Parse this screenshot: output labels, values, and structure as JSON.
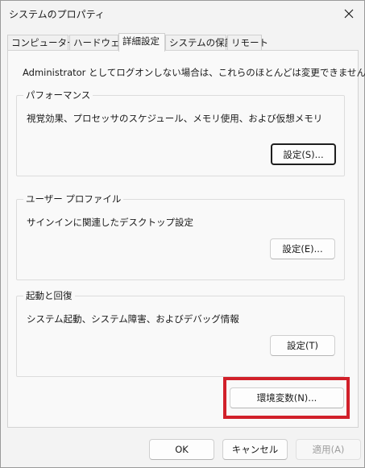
{
  "window": {
    "title": "システムのプロパティ",
    "close_icon": "×"
  },
  "tabs": [
    {
      "label": "コンピューター名",
      "active": false
    },
    {
      "label": "ハードウェア",
      "active": false
    },
    {
      "label": "詳細設定",
      "active": true
    },
    {
      "label": "システムの保護",
      "active": false
    },
    {
      "label": "リモート",
      "active": false
    }
  ],
  "advanced": {
    "admin_note": "Administrator としてログオンしない場合は、これらのほとんどは変更できません。",
    "performance": {
      "title": "パフォーマンス",
      "description": "視覚効果、プロセッサのスケジュール、メモリ使用、および仮想メモリ",
      "button": "設定(S)..."
    },
    "user_profiles": {
      "title": "ユーザー プロファイル",
      "description": "サインインに関連したデスクトップ設定",
      "button": "設定(E)..."
    },
    "startup_recovery": {
      "title": "起動と回復",
      "description": "システム起動、システム障害、およびデバッグ情報",
      "button": "設定(T)"
    },
    "env_vars_button": "環境変数(N)..."
  },
  "footer": {
    "ok": "OK",
    "cancel": "キャンセル",
    "apply": "適用(A)"
  },
  "colors": {
    "highlight": "#d1202a"
  }
}
